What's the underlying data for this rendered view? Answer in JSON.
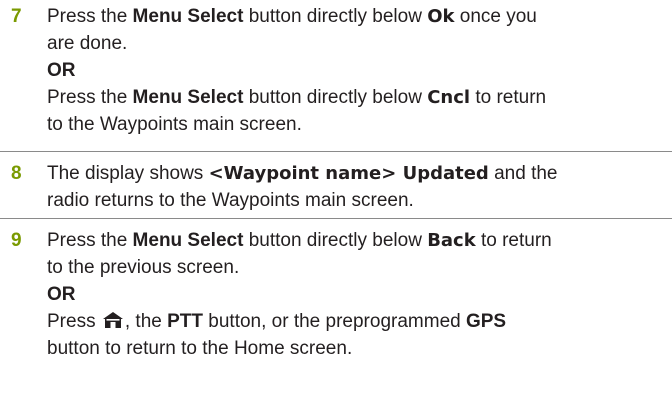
{
  "colors": {
    "step_number": "#7a9a01",
    "text": "#231f20",
    "separator": "#8a8a8a"
  },
  "steps": [
    {
      "number": "7",
      "lines": [
        {
          "t1": "Press the ",
          "b1": "Menu Select",
          "t2": " button directly below ",
          "d1": "Ok",
          "t3": " once you"
        },
        {
          "t1": "are done."
        },
        {
          "b1": "OR"
        },
        {
          "t1": "Press the ",
          "b1": "Menu Select",
          "t2": " button directly below ",
          "d1": "Cncl",
          "t3": " to return"
        },
        {
          "t1": "to the Waypoints main screen."
        }
      ]
    },
    {
      "number": "8",
      "lines": [
        {
          "t1": "The display shows ",
          "d1": "<Waypoint name> Updated",
          "t2": " and the"
        },
        {
          "t1": "radio returns to the Waypoints main screen."
        }
      ]
    },
    {
      "number": "9",
      "lines": [
        {
          "t1": "Press the ",
          "b1": "Menu Select",
          "t2": " button directly below ",
          "d1": "Back",
          "t3": " to return"
        },
        {
          "t1": "to the previous screen."
        },
        {
          "b1": "OR"
        },
        {
          "t1": "Press ",
          "icon": "home-icon",
          "t2": ", the ",
          "b1": "PTT",
          "t3": " button, or the preprogrammed ",
          "b2": "GPS"
        },
        {
          "t1": "button to return to the Home screen."
        }
      ]
    }
  ]
}
